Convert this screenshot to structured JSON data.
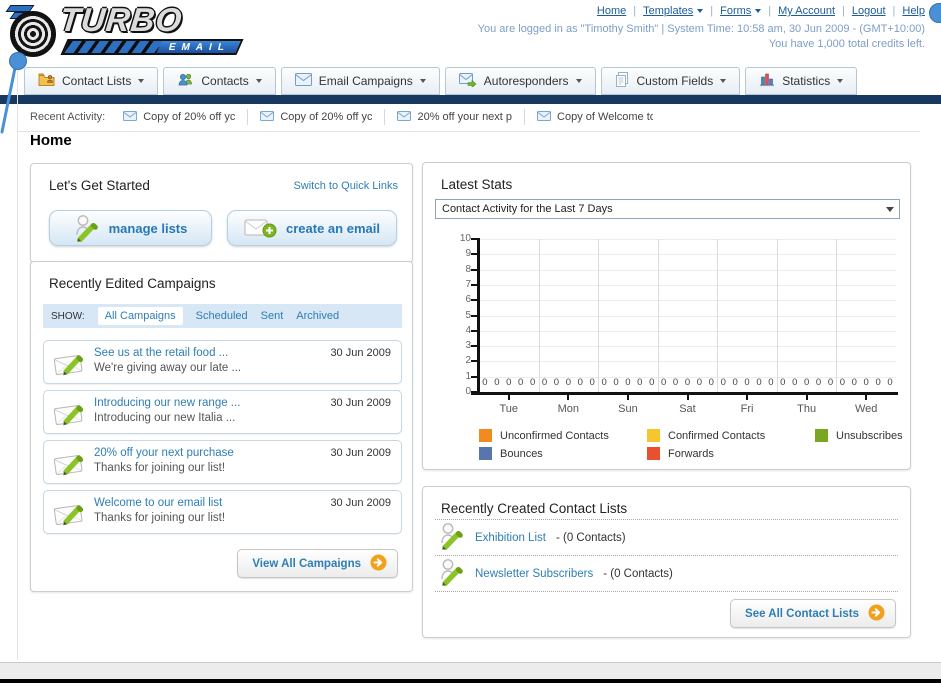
{
  "header": {
    "logo": {
      "line1": "TURBO",
      "line2": "EMAIL"
    },
    "link_separator": "|",
    "nav_links": [
      {
        "label": "Home",
        "dropdown": false
      },
      {
        "label": "Templates",
        "dropdown": true
      },
      {
        "label": "Forms",
        "dropdown": true
      },
      {
        "label": "My Account",
        "dropdown": false
      },
      {
        "label": "Logout",
        "dropdown": false
      },
      {
        "label": "Help",
        "dropdown": false
      }
    ],
    "status_line1": "You are logged in as \"Timothy Smith\" | System Time: 10:58 am, 30 Jun 2009 - (GMT+10:00)",
    "status_line2": "You have 1,000 total credits left."
  },
  "nav_tabs": [
    {
      "label": "Contact Lists",
      "icon": "folder-user-icon"
    },
    {
      "label": "Contacts",
      "icon": "people-icon"
    },
    {
      "label": "Email Campaigns",
      "icon": "envelope-icon"
    },
    {
      "label": "Autoresponders",
      "icon": "envelope-arrow-icon"
    },
    {
      "label": "Custom Fields",
      "icon": "pages-icon"
    },
    {
      "label": "Statistics",
      "icon": "bar-chart-icon"
    }
  ],
  "recent_activity": {
    "label": "Recent Activity:",
    "item_icon": "envelope-small-icon",
    "items": [
      "Copy of 20% off yc",
      "Copy of 20% off yc",
      "20% off your next p",
      "Copy of Welcome to"
    ]
  },
  "page_title": "Home",
  "get_started": {
    "title": "Let's Get Started",
    "switch_link": "Switch to Quick Links",
    "buttons": [
      {
        "label": "manage lists",
        "icon": "person-pencil-icon"
      },
      {
        "label": "create an email",
        "icon": "envelope-plus-icon"
      }
    ]
  },
  "campaigns": {
    "title": "Recently Edited Campaigns",
    "show_label": "SHOW:",
    "filters": [
      "All Campaigns",
      "Scheduled",
      "Sent",
      "Archived"
    ],
    "active_filter": "All Campaigns",
    "item_icon": "envelope-pencil-icon",
    "items": [
      {
        "title": "See us at the retail food ...",
        "subtitle": "We're giving away our late ...",
        "date": "30 Jun 2009"
      },
      {
        "title": "Introducing our new range ...",
        "subtitle": "Introducing our new Italia ...",
        "date": "30 Jun 2009"
      },
      {
        "title": "20% off your next purchase",
        "subtitle": "Thanks for joining our list!",
        "date": "30 Jun 2009"
      },
      {
        "title": "Welcome to our email list",
        "subtitle": "Thanks for joining our list!",
        "date": "30 Jun 2009"
      }
    ],
    "view_all_label": "View All Campaigns",
    "view_all_icon": "arrow-circle-icon"
  },
  "latest_stats": {
    "title": "Latest Stats",
    "dropdown_value": "Contact Activity for the Last 7 Days"
  },
  "chart_data": {
    "type": "bar",
    "title": "Contact Activity for the Last 7 Days",
    "categories": [
      "Tue",
      "Mon",
      "Sun",
      "Sat",
      "Fri",
      "Thu",
      "Wed"
    ],
    "series": [
      {
        "name": "Unconfirmed Contacts",
        "color": "#f18a1f",
        "values": [
          0,
          0,
          0,
          0,
          0,
          0,
          0
        ]
      },
      {
        "name": "Confirmed Contacts",
        "color": "#f6c72d",
        "values": [
          0,
          0,
          0,
          0,
          0,
          0,
          0
        ]
      },
      {
        "name": "Unsubscribes",
        "color": "#7aa722",
        "values": [
          0,
          0,
          0,
          0,
          0,
          0,
          0
        ]
      },
      {
        "name": "Bounces",
        "color": "#5876ac",
        "values": [
          0,
          0,
          0,
          0,
          0,
          0,
          0
        ]
      },
      {
        "name": "Forwards",
        "color": "#e8502f",
        "values": [
          0,
          0,
          0,
          0,
          0,
          0,
          0
        ]
      }
    ],
    "xlabel": "",
    "ylabel": "",
    "ylim": [
      0,
      10
    ],
    "ytick_step": 1,
    "grid": true,
    "legend_position": "bottom",
    "value_labels_shown": true
  },
  "contact_lists": {
    "title": "Recently Created Contact Lists",
    "item_icon": "person-pencil-icon",
    "items": [
      {
        "name": "Exhibition List",
        "detail": "- (0 Contacts)"
      },
      {
        "name": "Newsletter Subscribers",
        "detail": "- (0 Contacts)"
      }
    ],
    "see_all_label": "See All Contact Lists",
    "see_all_icon": "arrow-circle-icon"
  }
}
